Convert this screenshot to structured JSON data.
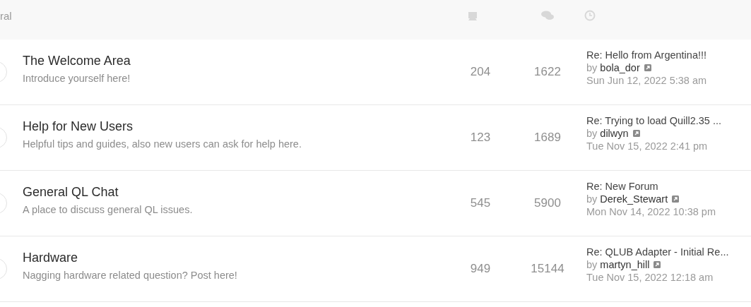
{
  "header": {
    "title": "ral"
  },
  "forums": [
    {
      "title": "The Welcome Area",
      "description": "Introduce yourself here!",
      "topics": "204",
      "posts": "1622",
      "last_post": {
        "subject": "Re: Hello from Argentina!!!",
        "by": "by",
        "author": "bola_dor",
        "date": "Sun Jun 12, 2022 5:38 am"
      }
    },
    {
      "title": "Help for New Users",
      "description": "Helpful tips and guides, also new users can ask for help here.",
      "topics": "123",
      "posts": "1689",
      "last_post": {
        "subject": "Re: Trying to load Quill2.35 ...",
        "by": "by",
        "author": "dilwyn",
        "date": "Tue Nov 15, 2022 2:41 pm"
      }
    },
    {
      "title": "General QL Chat",
      "description": "A place to discuss general QL issues.",
      "topics": "545",
      "posts": "5900",
      "last_post": {
        "subject": "Re: New Forum",
        "by": "by",
        "author": "Derek_Stewart",
        "date": "Mon Nov 14, 2022 10:38 pm"
      }
    },
    {
      "title": "Hardware",
      "description": "Nagging hardware related question? Post here!",
      "topics": "949",
      "posts": "15144",
      "last_post": {
        "subject": "Re: QLUB Adapter - Initial Re...",
        "by": "by",
        "author": "martyn_hill",
        "date": "Tue Nov 15, 2022 12:18 am"
      }
    }
  ]
}
